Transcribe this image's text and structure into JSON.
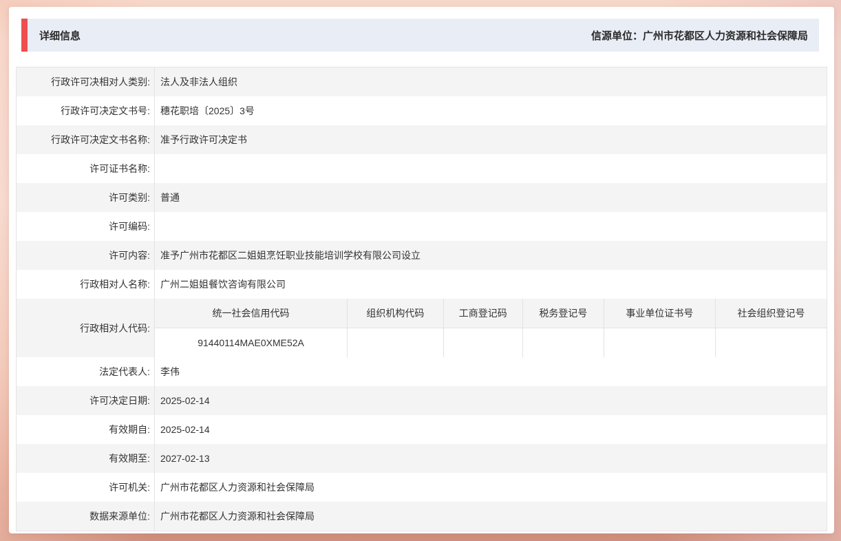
{
  "page": {
    "title": "详细信息",
    "source_label": "信源单位：广州市花都区人力资源和社会保障局"
  },
  "colors": {
    "accent_red": "#ee4e4e",
    "header_bg": "#e9edf6",
    "row_alt_bg": "#f4f4f4",
    "background_salmon": "#dc9b89"
  },
  "table": {
    "rows": [
      {
        "label": "行政许可决相对人类别:",
        "value": "法人及非法人组织"
      },
      {
        "label": "行政许可决定文书号:",
        "value": "穗花职培〔2025〕3号"
      },
      {
        "label": "行政许可决定文书名称:",
        "value": "准予行政许可决定书"
      },
      {
        "label": "许可证书名称:",
        "value": ""
      },
      {
        "label": "许可类别:",
        "value": "普通"
      },
      {
        "label": "许可编码:",
        "value": ""
      },
      {
        "label": "许可内容:",
        "value": "准予广州市花都区二姐姐烹饪职业技能培训学校有限公司设立"
      },
      {
        "label": "行政相对人名称:",
        "value": "广州二姐姐餐饮咨询有限公司"
      },
      {
        "label": "行政相对人代码:",
        "value": ""
      },
      {
        "label": "法定代表人:",
        "value": "李伟"
      },
      {
        "label": "许可决定日期:",
        "value": "2025-02-14"
      },
      {
        "label": "有效期自:",
        "value": "2025-02-14"
      },
      {
        "label": "有效期至:",
        "value": "2027-02-13"
      },
      {
        "label": "许可机关:",
        "value": "广州市花都区人力资源和社会保障局"
      },
      {
        "label": "数据来源单位:",
        "value": "广州市花都区人力资源和社会保障局"
      }
    ],
    "code_table": {
      "headers": [
        "统一社会信用代码",
        "组织机构代码",
        "工商登记码",
        "税务登记号",
        "事业单位证书号",
        "社会组织登记号"
      ],
      "values": [
        "91440114MAE0XME52A",
        "",
        "",
        "",
        "",
        ""
      ]
    }
  }
}
